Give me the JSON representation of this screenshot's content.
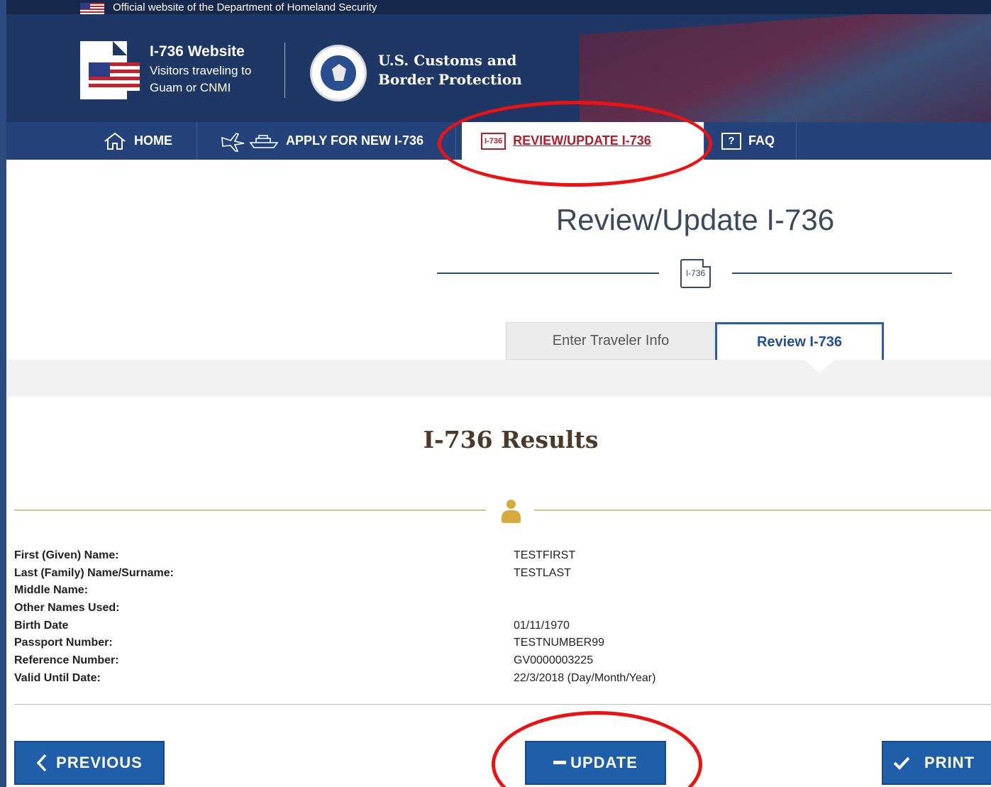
{
  "banner": {
    "text": "Official website of the Department of Homeland Security"
  },
  "brand": {
    "site_title": "I-736 Website",
    "site_subtitle_line1": "Visitors traveling to",
    "site_subtitle_line2": "Guam or CNMI",
    "agency_line1": "U.S. Customs and",
    "agency_line2": "Border Protection"
  },
  "nav": {
    "home": "HOME",
    "apply": "APPLY FOR NEW I-736",
    "review": "REVIEW/UPDATE I-736",
    "faq": "FAQ",
    "badge_text": "I-736",
    "faq_icon_text": "?"
  },
  "page": {
    "title": "Review/Update I-736",
    "doc_icon_text": "I-736",
    "tabs": {
      "enter": "Enter Traveler Info",
      "review": "Review I-736"
    },
    "results_title": "I-736 Results"
  },
  "details": [
    {
      "label": "First (Given) Name:",
      "value": "TESTFIRST"
    },
    {
      "label": "Last (Family) Name/Surname:",
      "value": "TESTLAST"
    },
    {
      "label": "Middle Name:",
      "value": ""
    },
    {
      "label": "Other Names Used:",
      "value": ""
    },
    {
      "label": "Birth Date",
      "value": "01/11/1970"
    },
    {
      "label": "Passport Number:",
      "value": "TESTNUMBER99"
    },
    {
      "label": "Reference Number:",
      "value": "GV0000003225"
    },
    {
      "label": "Valid Until Date:",
      "value": "22/3/2018 (Day/Month/Year)"
    }
  ],
  "buttons": {
    "previous": "PREVIOUS",
    "update": "UPDATE",
    "print": "PRINT"
  },
  "colors": {
    "header_navy": "#1e3764",
    "nav_blue": "#24437a",
    "button_blue": "#1f5ea8",
    "accent_red": "#b41e2b",
    "annotation_red": "#ee1111",
    "gold": "#d6a93c"
  }
}
